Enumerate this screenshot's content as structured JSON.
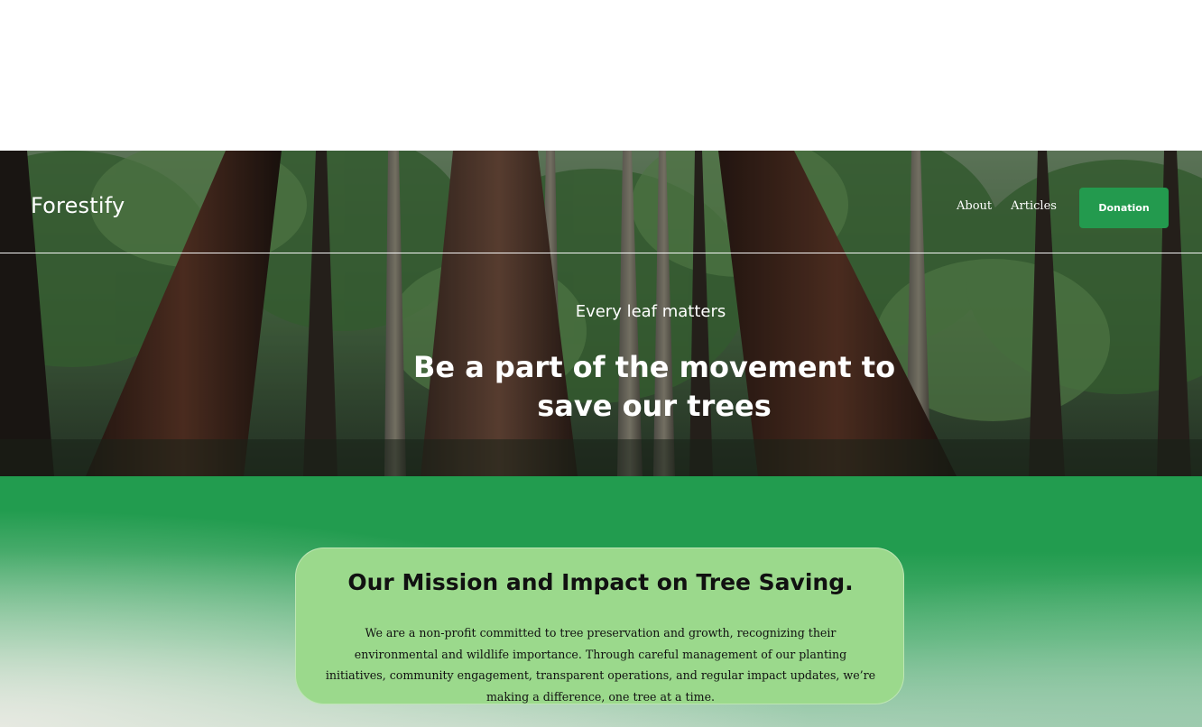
{
  "nav": {
    "logo": "Forestify",
    "links": [
      "About",
      "Articles"
    ],
    "donate_label": "Donation"
  },
  "hero": {
    "tagline": "Every leaf matters",
    "title": "Be a part of the movement to save our trees"
  },
  "mission": {
    "title": "Our Mission and Impact on Tree Saving.",
    "body": "We are a non-profit committed to tree preservation and growth, recognizing their environmental and wildlife importance. Through careful management of our planting initiatives, community engagement, transparent operations, and regular impact updates, we’re making a difference, one tree at a time."
  },
  "colors": {
    "accent": "#239a4e",
    "card": "#9bd98c",
    "section_green": "#229c4f"
  }
}
